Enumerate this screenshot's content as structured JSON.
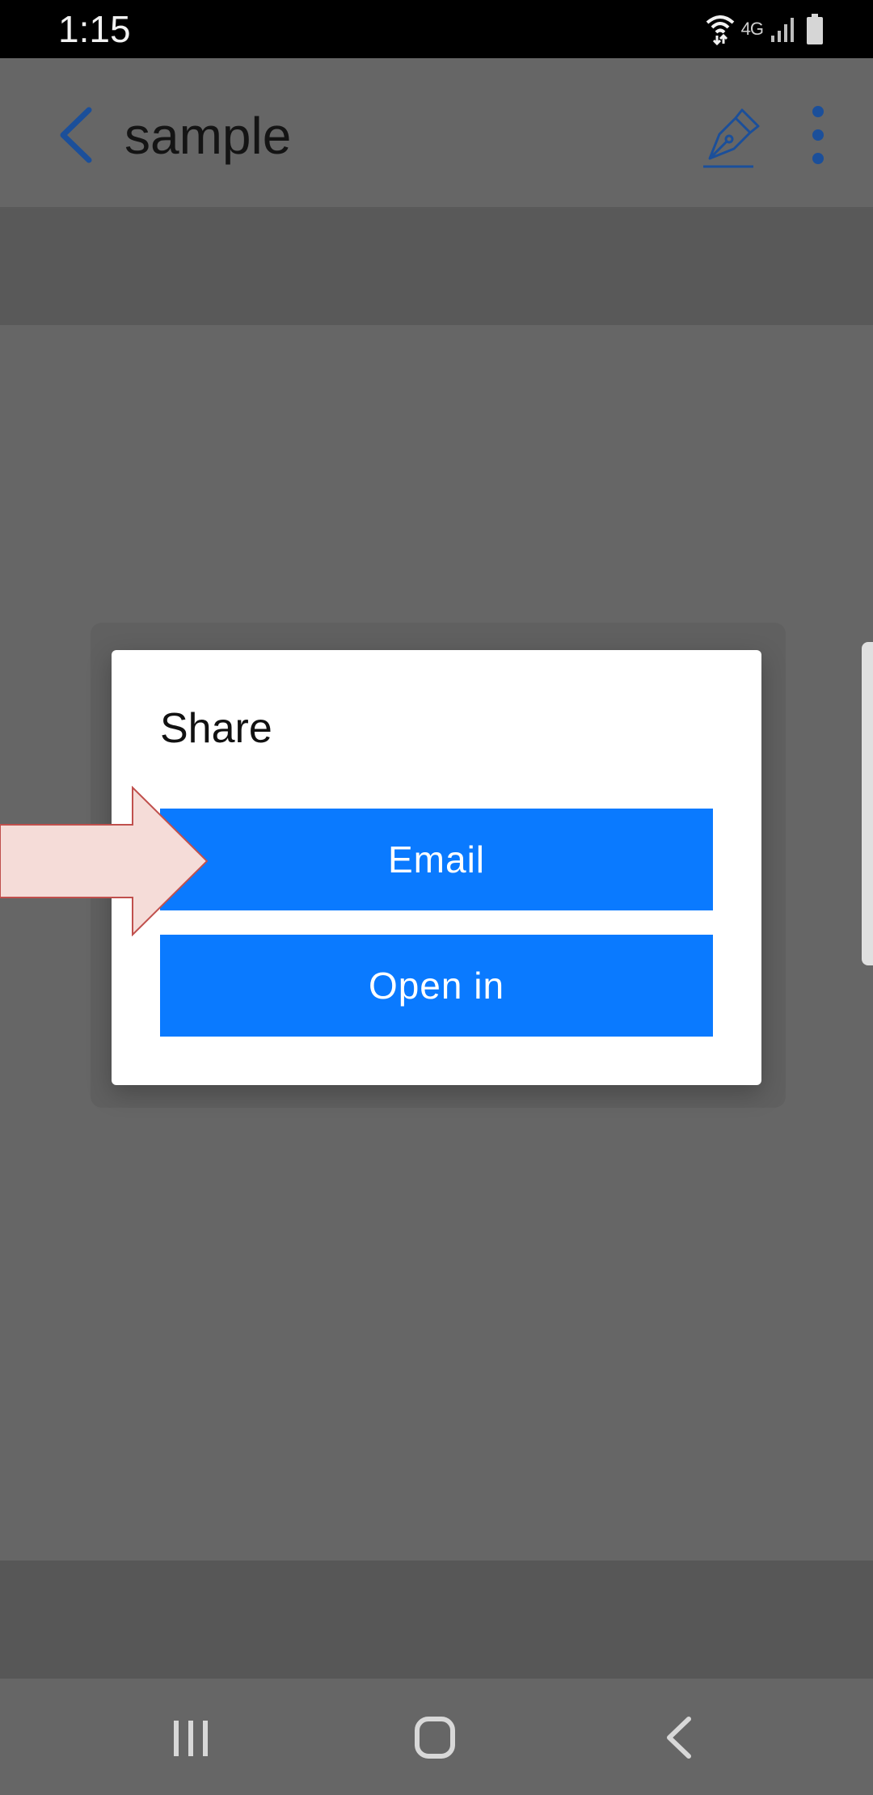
{
  "status_bar": {
    "time": "1:15",
    "network_label": "4G",
    "icons": [
      "wifi-icon",
      "signal-icon",
      "battery-icon"
    ]
  },
  "app_bar": {
    "title": "sample",
    "back_icon": "chevron-left-icon",
    "sign_icon": "fountain-pen-icon",
    "overflow_icon": "more-vertical-icon"
  },
  "dialog": {
    "title": "Share",
    "buttons": [
      {
        "label": "Email"
      },
      {
        "label": "Open in"
      }
    ]
  },
  "navigation_bar": {
    "icons": [
      "recents-icon",
      "home-icon",
      "back-icon"
    ]
  },
  "colors": {
    "accent": "#0a7aff",
    "icon_blue": "#1b4f9a",
    "scrim": "#666666",
    "callout_fill": "#f5dcd8",
    "callout_stroke": "#c0504d"
  }
}
